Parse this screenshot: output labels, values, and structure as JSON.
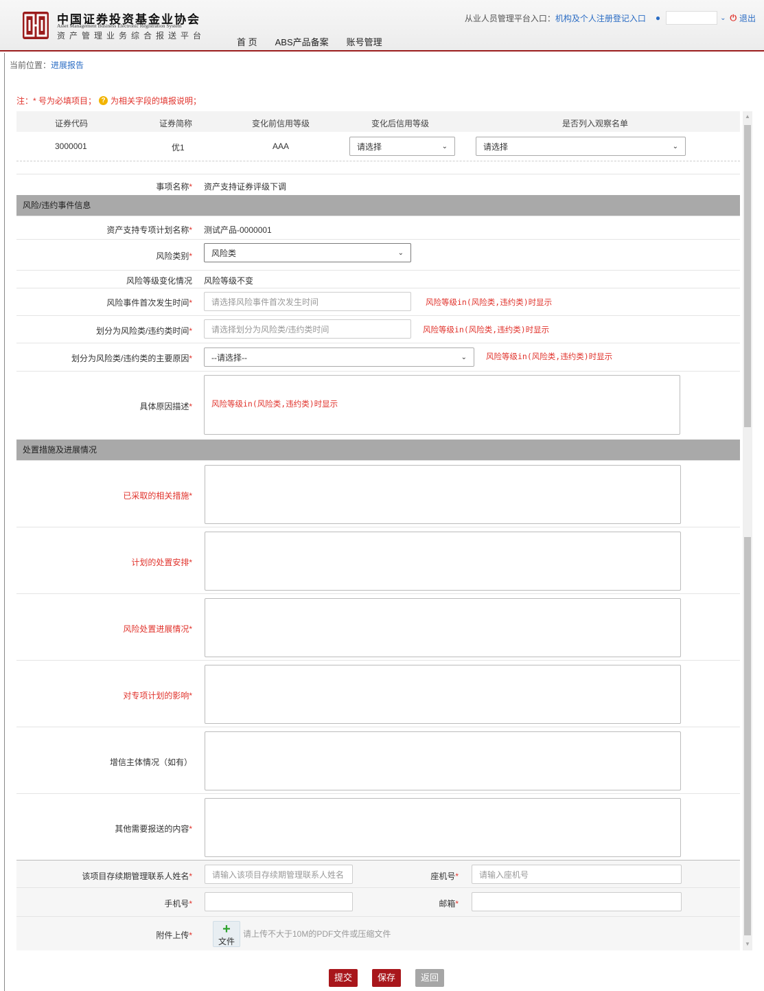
{
  "header": {
    "org_cn": "中国证券投资基金业协会",
    "org_en": "Asset Management Business Electronic Registration System",
    "system_name": "资产管理业务综合报送平台",
    "nav": [
      "首 页",
      "ABS产品备案",
      "账号管理"
    ],
    "entry_label": "从业人员管理平台入口：",
    "entry_link": "机构及个人注册登记入口",
    "logout": "退出"
  },
  "breadcrumb": {
    "prefix": "当前位置：",
    "current": "进展报告"
  },
  "note": {
    "text1": "注：* 号为必填项目；",
    "text2": "为相关字段的填报说明；"
  },
  "securities_table": {
    "headers": [
      "证券代码",
      "证券简称",
      "变化前信用等级",
      "变化后信用等级",
      "是否列入观察名单"
    ],
    "row": {
      "code": "3000001",
      "short_name": "优1",
      "rating_before": "AAA",
      "rating_after": "请选择",
      "watchlist": "请选择"
    }
  },
  "form": {
    "event_name_label": "事项名称",
    "event_name_value": "资产支持证券评级下调",
    "section1": "风险/违约事件信息",
    "plan_name_label": "资产支持专项计划名称",
    "plan_name_value": "测试产品-0000001",
    "risk_type_label": "风险类别",
    "risk_type_value": "风险类",
    "risk_change_label": "风险等级变化情况",
    "risk_change_value": "风险等级不变",
    "first_time_label": "风险事件首次发生时间",
    "first_time_placeholder": "请选择风险事件首次发生时间",
    "classify_time_label": "划分为风险类/违约类时间",
    "classify_time_placeholder": "请选择划分为风险类/违约类时间",
    "main_reason_label": "划分为风险类/违约类的主要原因",
    "main_reason_value": "--请选择--",
    "desc_label": "具体原因描述",
    "hint": "风险等级in(风险类,违约类)时显示",
    "section2": "处置措施及进展情况",
    "measures_label": "已采取的相关措施",
    "plan_label": "计划的处置安排",
    "progress_label": "风险处置进展情况",
    "impact_label": "对专项计划的影响",
    "credit_label": "增信主体情况（如有）",
    "other_label": "其他需要报送的内容",
    "contact_label": "该项目存续期管理联系人姓名",
    "contact_placeholder": "请输入该项目存续期管理联系人姓名",
    "landline_label": "座机号",
    "landline_placeholder": "请输入座机号",
    "mobile_label": "手机号",
    "email_label": "邮箱",
    "attach_label": "附件上传",
    "upload_btn": "文件",
    "upload_tip": "请上传不大于10M的PDF文件或压缩文件",
    "star": "*"
  },
  "buttons": {
    "submit": "提交",
    "save": "保存",
    "back": "返回"
  }
}
